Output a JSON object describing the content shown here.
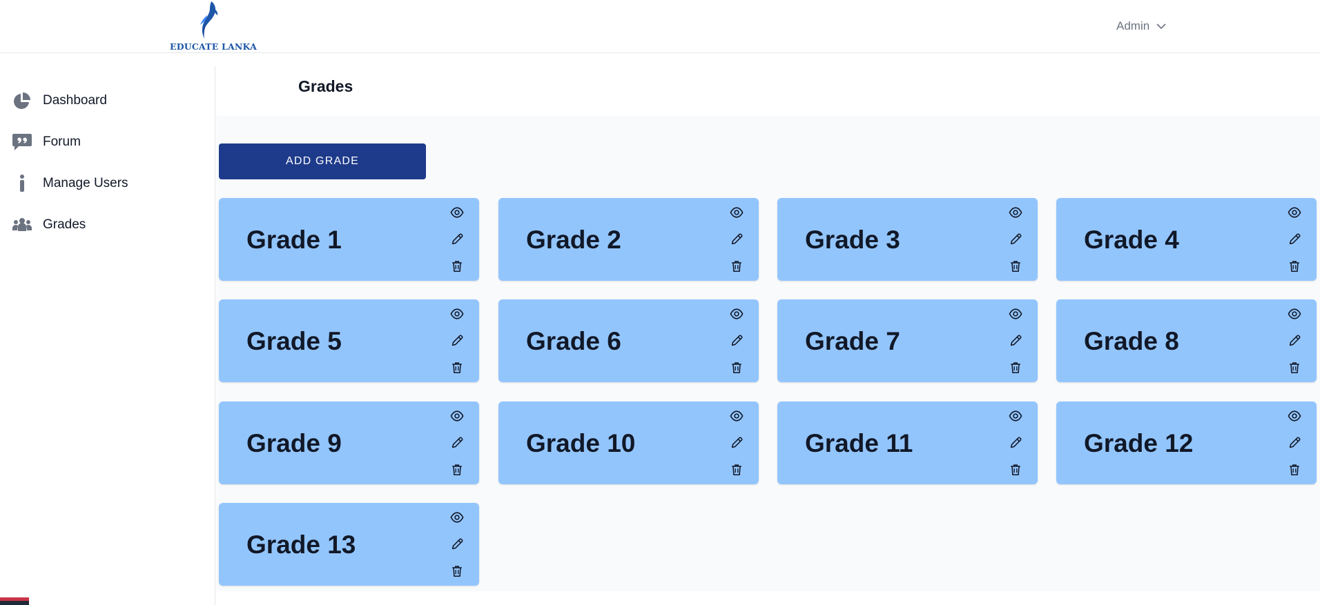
{
  "header": {
    "brand": "EDUCATE LANKA",
    "user_menu_label": "Admin"
  },
  "sidebar": {
    "items": [
      {
        "label": "Dashboard",
        "icon": "pie-chart-icon"
      },
      {
        "label": "Forum",
        "icon": "quote-bubble-icon"
      },
      {
        "label": "Manage Users",
        "icon": "person-icon"
      },
      {
        "label": "Grades",
        "icon": "users-group-icon"
      }
    ]
  },
  "page": {
    "title": "Grades",
    "add_button_label": "ADD GRADE"
  },
  "grades": [
    {
      "name": "Grade 1"
    },
    {
      "name": "Grade 2"
    },
    {
      "name": "Grade 3"
    },
    {
      "name": "Grade 4"
    },
    {
      "name": "Grade 5"
    },
    {
      "name": "Grade 6"
    },
    {
      "name": "Grade 7"
    },
    {
      "name": "Grade 8"
    },
    {
      "name": "Grade 9"
    },
    {
      "name": "Grade 10"
    },
    {
      "name": "Grade 11"
    },
    {
      "name": "Grade 12"
    },
    {
      "name": "Grade 13"
    }
  ],
  "colors": {
    "primary_button": "#1e3a8a",
    "card_background": "#93c5fd",
    "brand_blue": "#1e56a8"
  }
}
